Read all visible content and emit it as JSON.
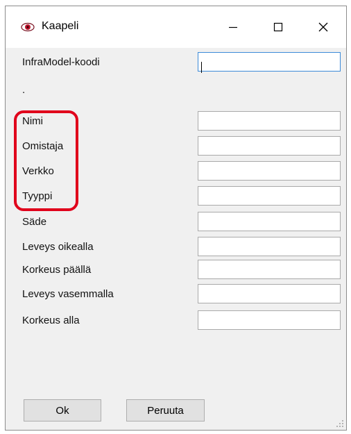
{
  "window": {
    "title": "Kaapeli",
    "icon": "eye-icon",
    "controls": {
      "minimize": "—",
      "maximize": "☐",
      "close": "✕"
    }
  },
  "form": {
    "infra_label": "InfraModel-koodi",
    "infra_value": "",
    "separator_text": ".",
    "fields": [
      {
        "label": "Nimi",
        "value": ""
      },
      {
        "label": "Omistaja",
        "value": ""
      },
      {
        "label": "Verkko",
        "value": ""
      },
      {
        "label": "Tyyppi",
        "value": ""
      },
      {
        "label": "Säde",
        "value": ""
      },
      {
        "label": "Leveys oikealla",
        "value": ""
      },
      {
        "label": "Korkeus päällä",
        "value": ""
      },
      {
        "label": "Leveys vasemmalla",
        "value": ""
      },
      {
        "label": "Korkeus alla",
        "value": ""
      }
    ]
  },
  "buttons": {
    "ok": "Ok",
    "cancel": "Peruuta"
  },
  "colors": {
    "highlight": "#e0001b",
    "window_bg": "#f0f0f0",
    "focus_border": "#3b8ad8"
  }
}
